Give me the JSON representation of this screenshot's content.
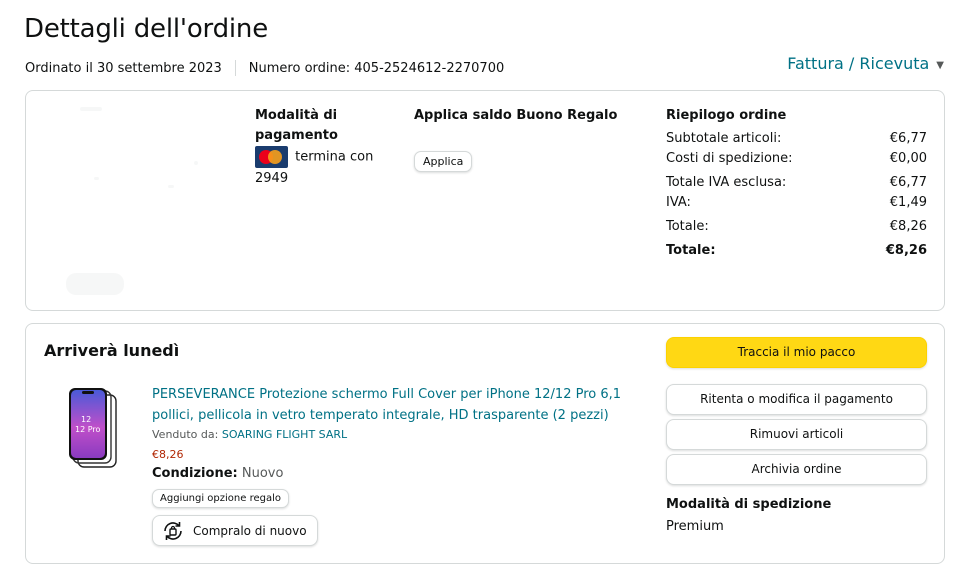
{
  "header": {
    "title": "Dettagli dell'ordine",
    "ordered_on": "Ordinato il 30 settembre 2023",
    "order_number": "Numero ordine: 405-2524612-2270700",
    "invoice_link": "Fattura / Ricevuta"
  },
  "payment": {
    "title": "Modalità di pagamento",
    "card_text": "termina con",
    "card_last_digits": "2949",
    "card_icon": "mastercard-icon"
  },
  "gift_card": {
    "title": "Applica saldo Buono Regalo",
    "apply_label": "Applica"
  },
  "summary": {
    "title": "Riepilogo ordine",
    "rows": [
      {
        "label": "Subtotale articoli:",
        "value": "€6,77"
      },
      {
        "label": "Costi di spedizione:",
        "value": "€0,00"
      },
      {
        "label": "Totale IVA esclusa:",
        "value": "€6,77"
      },
      {
        "label": "IVA:",
        "value": "€1,49"
      },
      {
        "label": "Totale:",
        "value": "€8,26"
      }
    ],
    "grand_total_label": "Totale:",
    "grand_total_value": "€8,26"
  },
  "shipment": {
    "arrival": "Arriverà lunedì",
    "product": {
      "title": "PERSEVERANCE Protezione schermo Full Cover per iPhone 12/12 Pro 6,1 pollici, pellicola in vetro temperato integrale, HD trasparente (2 pezzi)",
      "image_label": "12\n12 Pro",
      "seller_label": "Venduto da:",
      "seller_name": "SOARING FLIGHT SARL",
      "price": "€8,26",
      "condition_label": "Condizione:",
      "condition_value": "Nuovo",
      "gift_option": "Aggiungi opzione regalo",
      "buy_again": "Compralo di nuovo"
    },
    "actions": {
      "track": "Traccia il mio pacco",
      "retry_payment": "Ritenta o modifica il pagamento",
      "remove_items": "Rimuovi articoli",
      "archive": "Archivia ordine"
    },
    "shipping_method_title": "Modalità di spedizione",
    "shipping_method_value": "Premium"
  },
  "colors": {
    "link": "#007185",
    "primary_button": "#ffd814",
    "price": "#b12704",
    "border": "#d5d9d9"
  }
}
